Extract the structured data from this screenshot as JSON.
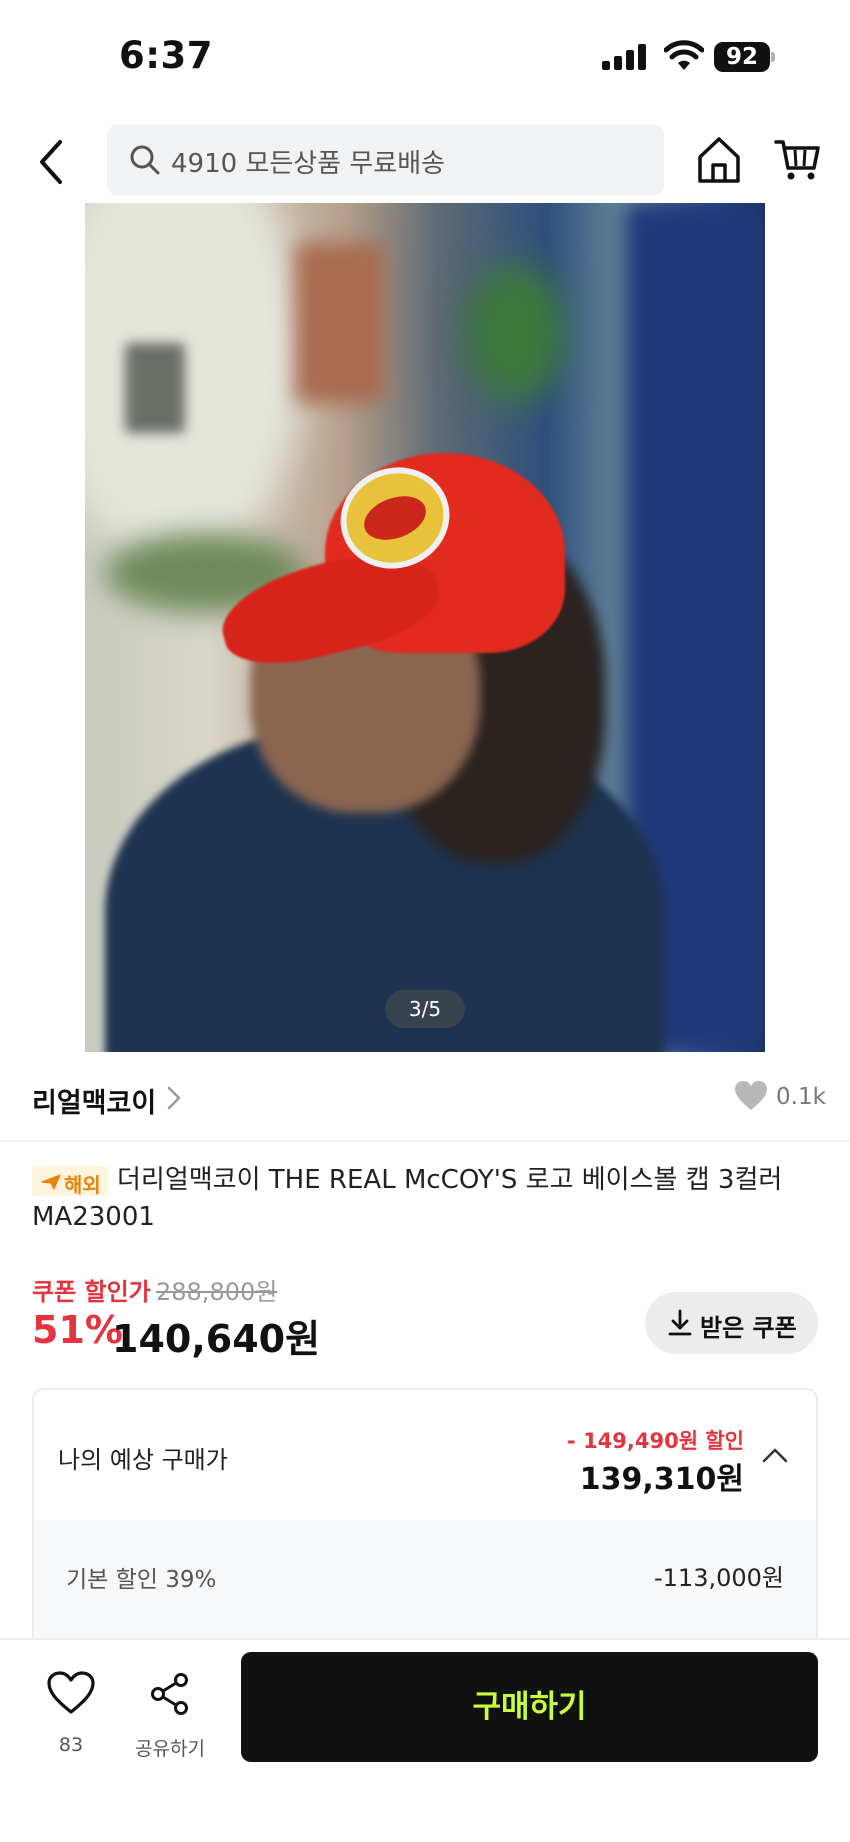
{
  "status_bar": {
    "time": "6:37",
    "battery": "92",
    "icons": [
      "signal-icon",
      "wifi-icon",
      "battery-icon"
    ]
  },
  "header": {
    "search_text": "4910 모든상품 무료배송",
    "icons": [
      "back-arrow-icon",
      "search-icon",
      "home-icon",
      "cart-icon"
    ]
  },
  "gallery": {
    "counter": "3/5"
  },
  "brand": {
    "name": "리얼맥코이",
    "likes": "0.1k"
  },
  "product": {
    "badge": "해외",
    "title": "더리얼맥코이 THE REAL McCOY'S 로고 베이스볼 캡 3컬러 MA23001"
  },
  "price": {
    "coupon_label": "쿠폰 할인가",
    "original": "288,800원",
    "discount_rate": "51%",
    "final": "140,640원",
    "coupon_button": "받은 쿠폰"
  },
  "expected": {
    "label": "나의 예상 구매가",
    "discount": "- 149,490원 할인",
    "price": "139,310원",
    "basic_label": "기본 할인 39%",
    "basic_value": "-113,000원"
  },
  "bottom_bar": {
    "wishlist_count": "83",
    "share_label": "공유하기",
    "buy_label": "구매하기"
  },
  "colors": {
    "accent_red": "#e3343f",
    "buy_button_bg": "#111111",
    "buy_button_text": "#c7ff3a",
    "badge_orange": "#e8830d"
  }
}
